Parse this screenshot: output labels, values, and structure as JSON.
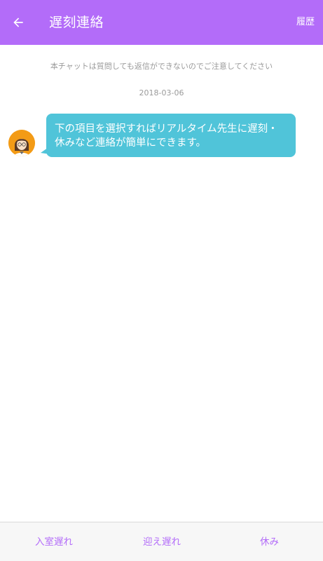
{
  "header": {
    "title": "遅刻連絡",
    "history_label": "履歴",
    "back_icon": "arrow-left-icon",
    "background_color": "#b36cf9"
  },
  "chat": {
    "notice": "本チャットは質問しても返信ができないのでご注意してください",
    "date": "2018-03-06",
    "messages": [
      {
        "sender_avatar": "teacher-avatar",
        "text": "下の項目を選択すればリアルタイム先生に遅刻・休みなど連絡が簡単にできます。",
        "bubble_color": "#50c4d9"
      }
    ]
  },
  "bottom_bar": {
    "buttons": [
      {
        "label": "入室遅れ"
      },
      {
        "label": "迎え遅れ"
      },
      {
        "label": "休み"
      }
    ],
    "accent_color": "#b36cf9"
  }
}
